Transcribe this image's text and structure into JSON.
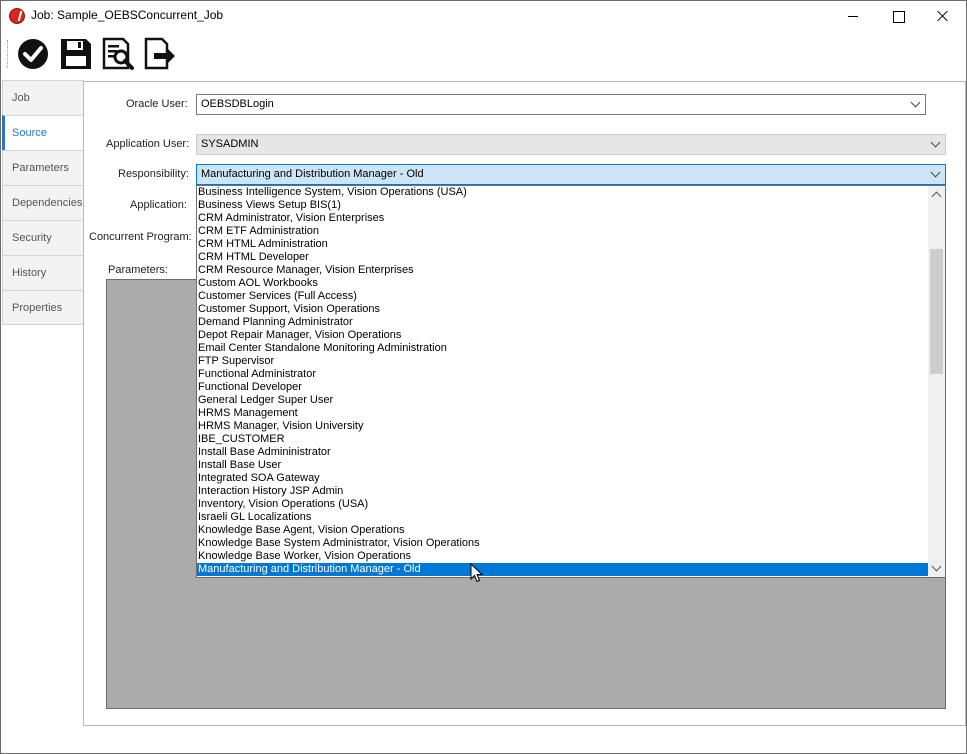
{
  "window": {
    "title": "Job: Sample_OEBSConcurrent_Job"
  },
  "toolbar": {
    "buttons": [
      {
        "name": "ok",
        "icon": "check-circle-icon"
      },
      {
        "name": "save",
        "icon": "floppy-disk-icon"
      },
      {
        "name": "preview",
        "icon": "document-search-icon"
      },
      {
        "name": "export",
        "icon": "document-export-icon"
      }
    ]
  },
  "tabs": [
    {
      "label": "Job"
    },
    {
      "label": "Source",
      "active": true
    },
    {
      "label": "Parameters"
    },
    {
      "label": "Dependencies"
    },
    {
      "label": "Security"
    },
    {
      "label": "History"
    },
    {
      "label": "Properties"
    }
  ],
  "form": {
    "oracle_user_label": "Oracle User:",
    "oracle_user_value": "OEBSDBLogin",
    "application_user_label": "Application User:",
    "application_user_value": "SYSADMIN",
    "responsibility_label": "Responsibility:",
    "responsibility_value": "Manufacturing and Distribution Manager - Old",
    "application_label": "Application:",
    "concurrent_program_label": "Concurrent Program:",
    "parameters_label": "Parameters:"
  },
  "responsibility_options": [
    "Business Intelligence System, Vision Operations (USA)",
    "Business Views Setup BIS(1)",
    "CRM Administrator, Vision Enterprises",
    "CRM ETF Administration",
    "CRM HTML Administration",
    "CRM HTML Developer",
    "CRM Resource Manager, Vision Enterprises",
    "Custom AOL Workbooks",
    "Customer Services (Full Access)",
    "Customer Support, Vision Operations",
    "Demand Planning Administrator",
    "Depot Repair Manager, Vision Operations",
    "Email Center Standalone Monitoring Administration",
    "FTP Supervisor",
    "Functional Administrator",
    "Functional Developer",
    "General Ledger Super User",
    "HRMS Management",
    "HRMS Manager, Vision University",
    "IBE_CUSTOMER",
    "Install Base Admininistrator",
    "Install Base User",
    "Integrated SOA Gateway",
    "Interaction History JSP Admin",
    "Inventory, Vision Operations (USA)",
    "Israeli GL Localizations",
    "Knowledge Base Agent, Vision Operations",
    "Knowledge Base System Administrator, Vision Operations",
    "Knowledge Base Worker, Vision Operations",
    "Manufacturing and Distribution Manager - Old"
  ],
  "selected_option_index": 29,
  "colors": {
    "selection": "#0078d7",
    "active_tab_text": "#2a73c5",
    "parameters_area": "#ababab",
    "focused_field": "#cce4f7"
  }
}
